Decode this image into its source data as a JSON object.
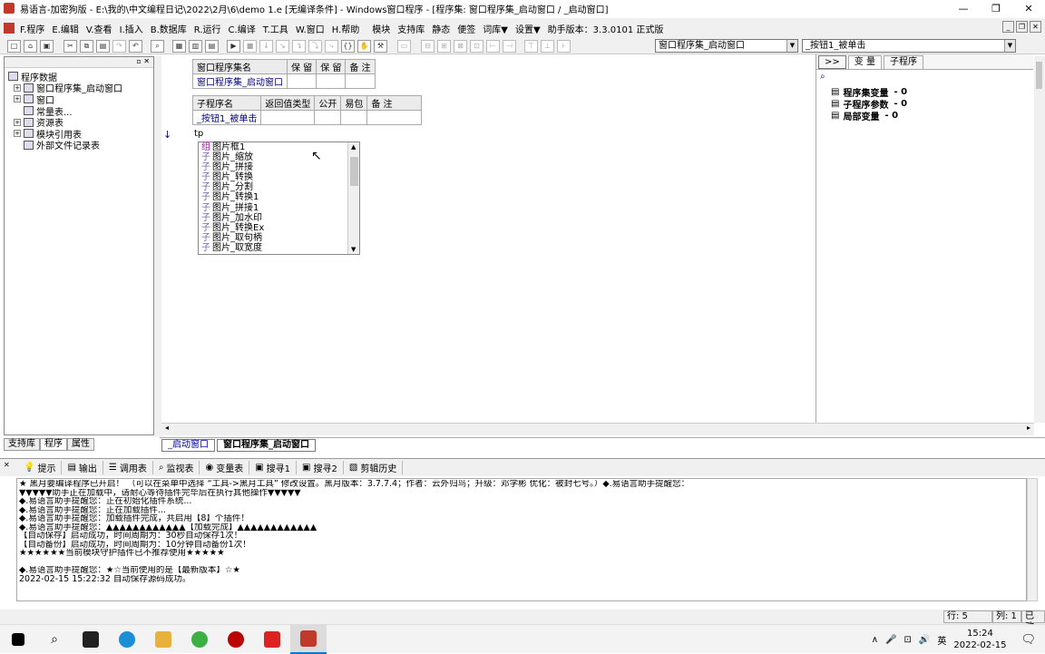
{
  "window": {
    "title": "易语言-加密狗版 - E:\\我的\\中文编程日记\\2022\\2月\\6\\demo 1.e [无编译条件] - Windows窗口程序 - [程序集: 窗口程序集_启动窗口 / _启动窗口]",
    "min": "—",
    "max": "❐",
    "close": "✕"
  },
  "menu": [
    "F.程序",
    "E.编辑",
    "V.查看",
    "I.插入",
    "B.数据库",
    "R.运行",
    "C.编译",
    "T.工具",
    "W.窗口",
    "H.帮助",
    "模块",
    "支持库",
    "静态",
    "便签",
    "词库▼",
    "设置▼",
    "助手版本：3.3.0101 正式版"
  ],
  "mdi": [
    "_",
    "❐",
    "✕"
  ],
  "toolbar": {
    "combo1": "窗口程序集_启动窗口",
    "combo2": "_按钮1_被单击"
  },
  "left_panel": {
    "tree": [
      {
        "label": "程序数据",
        "exp": "",
        "indent": 0
      },
      {
        "label": "窗口程序集_启动窗口",
        "exp": "+",
        "indent": 1
      },
      {
        "label": "窗口",
        "exp": "+",
        "indent": 1
      },
      {
        "label": "常量表...",
        "exp": "",
        "indent": 1
      },
      {
        "label": "资源表",
        "exp": "+",
        "indent": 1
      },
      {
        "label": "模块引用表",
        "exp": "+",
        "indent": 1
      },
      {
        "label": "外部文件记录表",
        "exp": "",
        "indent": 1
      }
    ],
    "tabs": [
      "支持库",
      "程序",
      "属性"
    ]
  },
  "editor": {
    "table1": {
      "headers": [
        "窗口程序集名",
        "保 留",
        "保 留",
        "备 注"
      ],
      "row": [
        "窗口程序集_启动窗口",
        "",
        "",
        ""
      ]
    },
    "table2": {
      "headers": [
        "子程序名",
        "返回值类型",
        "公开",
        "易包",
        "备 注"
      ],
      "row": [
        "_按钮1_被单击",
        "",
        "",
        "",
        ""
      ]
    },
    "arrow": "↓",
    "code": "tp",
    "popup": [
      {
        "tag": "组",
        "label": "图片框1"
      },
      {
        "tag": "子",
        "label": "图片_缩放"
      },
      {
        "tag": "子",
        "label": "图片_拼接"
      },
      {
        "tag": "子",
        "label": "图片_转换"
      },
      {
        "tag": "子",
        "label": "图片_分割"
      },
      {
        "tag": "子",
        "label": "图片_转换1"
      },
      {
        "tag": "子",
        "label": "图片_拼接1"
      },
      {
        "tag": "子",
        "label": "图片_加水印"
      },
      {
        "tag": "子",
        "label": "图片_转换Ex"
      },
      {
        "tag": "子",
        "label": "图片_取句柄"
      },
      {
        "tag": "子",
        "label": "图片_取宽度"
      }
    ]
  },
  "right_panel": {
    "expand": ">>",
    "tabs": [
      "变 量",
      "子程序"
    ],
    "search_icon": "⌕",
    "rows": [
      {
        "label": "程序集变量",
        "count": "- 0"
      },
      {
        "label": "子程序参数",
        "count": "- 0"
      },
      {
        "label": "局部变量",
        "count": "- 0"
      }
    ]
  },
  "doc_tabs": [
    "_启动窗口",
    "窗口程序集_启动窗口"
  ],
  "output_tabs": [
    "提示",
    "输出",
    "调用表",
    "监视表",
    "变量表",
    "搜寻1",
    "搜寻2",
    "剪辑历史"
  ],
  "output_lines": [
    "★ 黑月要编译程序已开启！ （可以在菜单中选择 “工具->黑月工具” 修改设置。黑月版本：3.7.7.4；作者：云外归鸟；升级：邓学彬 优化：被封七号。）◆.易语言助手提醒您：",
    "▼▼▼▼▼助手正在加载中，请耐心等待插件完毕后在执行其他操作▼▼▼▼▼",
    "◆.易语言助手提醒您：正在初始化插件系统...",
    "◆.易语言助手提醒您：正在加载插件...",
    "◆.易语言助手提醒您：加载插件完成，共启用【8】个插件！",
    "◆.易语言助手提醒您：▲▲▲▲▲▲▲▲▲▲▲▲【加载完成】▲▲▲▲▲▲▲▲▲▲▲▲",
    "【自动保存】启动成功，时间周期为：30秒自动保存1次！",
    "【自动备份】启动成功，时间周期为：10分钟自动备份1次！",
    "★★★★★★当前模块守护插件已不推荐使用★★★★★",
    "",
    "◆.易语言助手提醒您：★☆当前使用的是【最新版本】☆★",
    "2022-02-15 15:22:32 自动保存源码成功。"
  ],
  "status": {
    "line": "行: 5",
    "col": "列: 1",
    "mode": "已改"
  },
  "taskbar": {
    "lang": "英",
    "time": "15:24",
    "date": "2022-02-15"
  }
}
